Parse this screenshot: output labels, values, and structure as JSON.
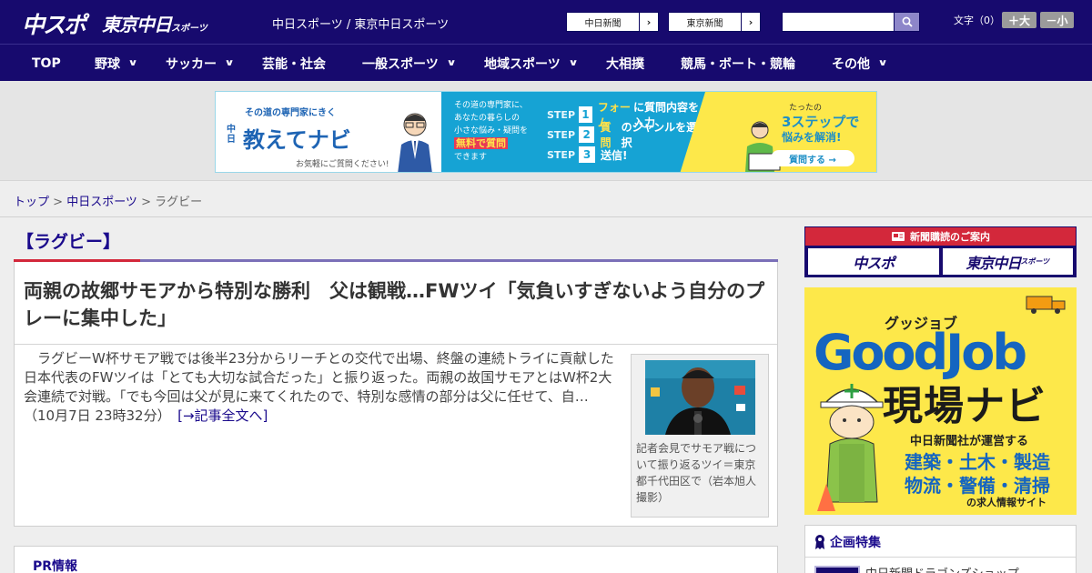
{
  "header": {
    "logo_chuspo": "中スポ",
    "logo_tokyo": "東京中日",
    "logo_tokyo_suffix": "スポーツ",
    "site_title": "中日スポーツ / 東京中日スポーツ",
    "links": [
      {
        "label": "中日新聞",
        "arrow": "›"
      },
      {
        "label": "東京新聞",
        "arrow": "›"
      }
    ],
    "search_placeholder": "",
    "font_size_label": "文字（0）",
    "font_up": "＋大",
    "font_down": "－小"
  },
  "nav": {
    "items": [
      {
        "label": "TOP",
        "has_dropdown": false
      },
      {
        "label": "野球",
        "has_dropdown": true
      },
      {
        "label": "サッカー",
        "has_dropdown": true
      },
      {
        "label": "芸能・社会",
        "has_dropdown": false
      },
      {
        "label": "一般スポーツ",
        "has_dropdown": true
      },
      {
        "label": "地域スポーツ",
        "has_dropdown": true
      },
      {
        "label": "大相撲",
        "has_dropdown": false
      },
      {
        "label": "競馬・ボート・競輪",
        "has_dropdown": false
      },
      {
        "label": "その他",
        "has_dropdown": true
      }
    ],
    "chevron": "∨"
  },
  "ad_banner": {
    "tagline": "その道の専門家にきく",
    "brand_prefix": "中日",
    "brand": "教えてナビ",
    "brand_note": "お気軽にご質問ください!",
    "desc_lines": [
      "その道の専門家に、",
      "あなたの暮らしの",
      "小さな悩み・疑問を"
    ],
    "desc_highlight": "無料で質問",
    "desc_end": "できます",
    "steps": [
      {
        "label": "STEP",
        "num": "1",
        "text_hl": "フォーム",
        "text": "に質問内容を入力"
      },
      {
        "label": "STEP",
        "num": "2",
        "text_hl": "質問",
        "text": "のジャンルを選択"
      },
      {
        "label": "STEP",
        "num": "3",
        "text_hl": "",
        "text": "送信!"
      }
    ],
    "right_small": "たったの",
    "right_big": "3ステップで",
    "right_big2": "悩みを解消!",
    "right_button": "質問する →"
  },
  "breadcrumb": {
    "items": [
      "トップ",
      "中日スポーツ"
    ],
    "separator": " > ",
    "current": "ラグビー"
  },
  "main": {
    "category": "【ラグビー】",
    "headline": "両親の故郷サモアから特別な勝利　父は観戦…FWツイ「気負いすぎないよう自分のプレーに集中した」",
    "lead": "ラグビーW杯サモア戦では後半23分からリーチとの交代で出場、終盤の連続トライに貢献した日本代表のFWツイは「とても大切な試合だった」と振り返った。両親の故国サモアとはW杯2大会連続で対戦。「でも今回は父が見に来てくれたので、特別な感情の部分は父に任せて、自…（10月7日 23時32分）",
    "read_more": "[→記事全文へ]",
    "photo_caption": "記者会見でサモア戦について振り返るツイ＝東京都千代田区で（岩本旭人撮影）",
    "pr_title": "PR情報"
  },
  "sidebar": {
    "subscribe_head": "新聞購読のご案内",
    "subscribe_logos": [
      {
        "name": "中スポ",
        "suffix": ""
      },
      {
        "name": "東京中日",
        "suffix": "スポーツ"
      }
    ],
    "goodjob": {
      "sub": "グッジョブ",
      "title": "GoodJob",
      "title2": "現場ナビ",
      "line1": "中日新聞社が運営する",
      "line2": "建築・土木・製造",
      "line3": "物流・警備・清掃",
      "line4": "の求人情報サイト"
    },
    "feature_title": "企画特集",
    "feature_item": "中日新聞ドラゴンズショップ"
  },
  "colors": {
    "header_bg": "#170a6e",
    "accent_red": "#d3283b",
    "link": "#1a0a8c",
    "ad_blue": "#16a3d4",
    "ad_yellow": "#fde84a"
  }
}
